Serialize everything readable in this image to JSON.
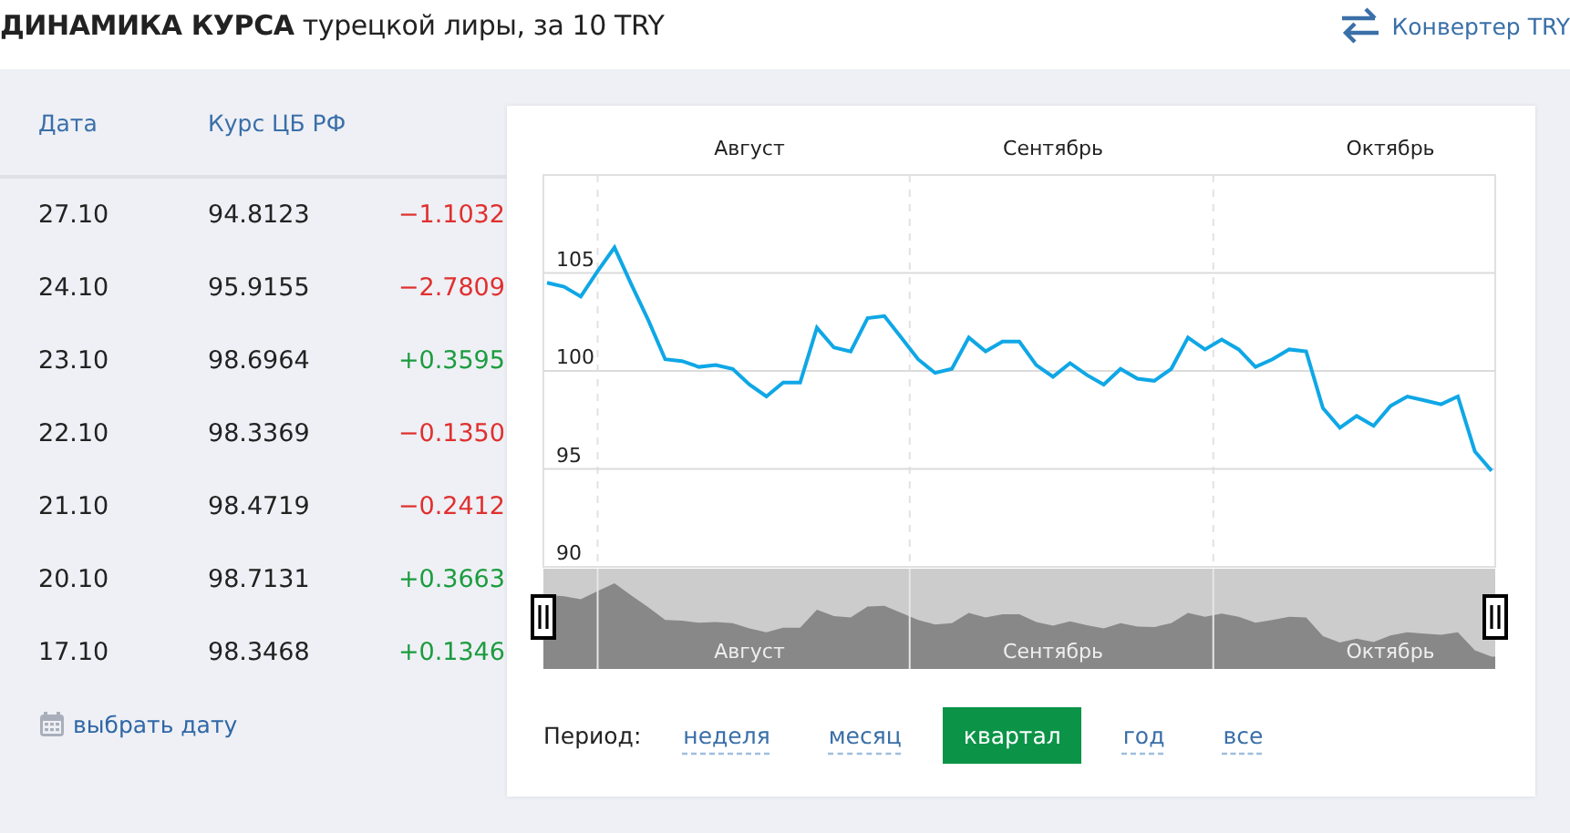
{
  "title": "**ДИНАМИКА КУРСА** турецкой лиры, за 10 TRY",
  "converter_link": "Конвертер TRY",
  "table": {
    "columns": [
      "Дата",
      "Курс ЦБ РФ"
    ],
    "rows": [
      {
        "date": "27.10",
        "rate": "94.8123",
        "change": "−1.1032",
        "kind": "down"
      },
      {
        "date": "24.10",
        "rate": "95.9155",
        "change": "−2.7809",
        "kind": "down"
      },
      {
        "date": "23.10",
        "rate": "98.6964",
        "change": "+0.3595",
        "kind": "up"
      },
      {
        "date": "22.10",
        "rate": "98.3369",
        "change": "−0.1350",
        "kind": "down"
      },
      {
        "date": "21.10",
        "rate": "98.4719",
        "change": "−0.2412",
        "kind": "down"
      },
      {
        "date": "20.10",
        "rate": "98.7131",
        "change": "+0.3663",
        "kind": "up"
      },
      {
        "date": "17.10",
        "rate": "98.3468",
        "change": "+0.1346",
        "kind": "up"
      }
    ]
  },
  "pick_date_link": "выбрать дату",
  "chart": {
    "chart_data": {
      "type": "line",
      "grid": true,
      "ylim": [
        90,
        110
      ],
      "yticks": [
        90,
        95,
        100,
        105
      ],
      "categories": [
        null,
        null,
        null,
        null,
        null,
        null,
        null,
        null,
        null,
        null,
        null,
        null,
        "Август",
        null,
        null,
        null,
        null,
        null,
        null,
        null,
        null,
        null,
        null,
        null,
        null,
        null,
        null,
        null,
        null,
        null,
        "Сентябрь",
        null,
        null,
        null,
        null,
        null,
        null,
        null,
        null,
        null,
        null,
        null,
        null,
        null,
        null,
        null,
        null,
        null,
        null,
        null,
        "Октябрь",
        null,
        null,
        null,
        null,
        null,
        null
      ],
      "series": [
        {
          "color": "#0fa7e6",
          "values": [
            104.5,
            104.3,
            103.8,
            105.1,
            106.3,
            104.4,
            102.6,
            100.6,
            100.5,
            100.2,
            100.3,
            100.1,
            99.3,
            98.7,
            99.4,
            99.4,
            102.2,
            101.2,
            101,
            102.7,
            102.8,
            101.7,
            100.6,
            99.9,
            100.1,
            101.7,
            101,
            101.5,
            101.5,
            100.3,
            99.7,
            100.4,
            99.8,
            99.3,
            100.1,
            99.6,
            99.5,
            100.1,
            101.7,
            101.1,
            101.6,
            101.1,
            100.2,
            100.6,
            101.1,
            101,
            98.1,
            97.1,
            97.7,
            97.2,
            98.2,
            98.7,
            98.5,
            98.3,
            98.7,
            95.9,
            94.9
          ]
        }
      ]
    },
    "navigator_labels": [
      "Август",
      "Сентябрь",
      "Октябрь"
    ]
  },
  "period": {
    "label": "Период:",
    "options": [
      {
        "label": "неделя",
        "selected": false
      },
      {
        "label": "месяц",
        "selected": false
      },
      {
        "label": "квартал",
        "selected": true
      },
      {
        "label": "год",
        "selected": false
      },
      {
        "label": "все",
        "selected": false
      }
    ]
  }
}
